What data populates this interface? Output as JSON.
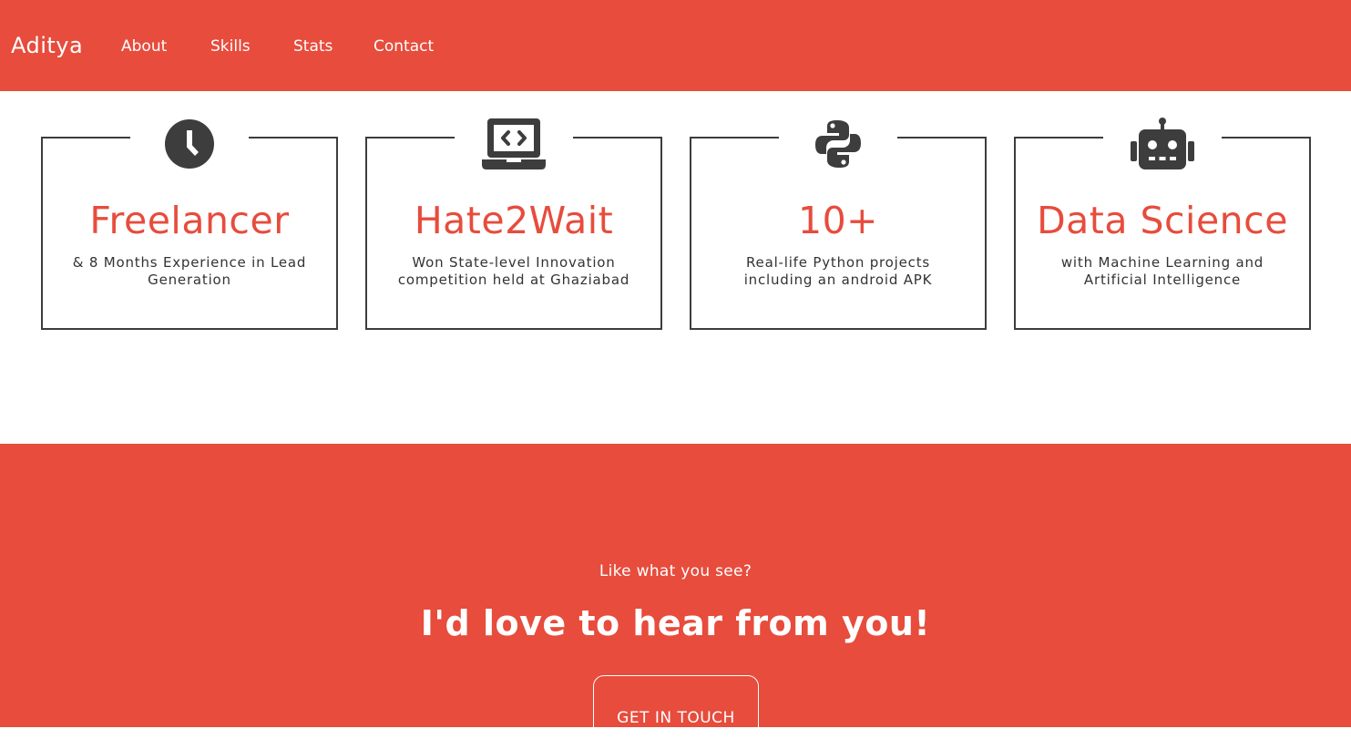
{
  "navbar": {
    "brand": "Aditya",
    "links": [
      {
        "label": "About"
      },
      {
        "label": "Skills"
      },
      {
        "label": "Stats"
      },
      {
        "label": "Contact"
      }
    ]
  },
  "stats": [
    {
      "icon": "clock-icon",
      "title": "Freelancer",
      "description": "& 8 Months Experience in Lead Generation"
    },
    {
      "icon": "laptop-code-icon",
      "title": "Hate2Wait",
      "description": "Won State-level Innovation competition held at Ghaziabad"
    },
    {
      "icon": "python-icon",
      "title": "10+",
      "description": "Real-life Python projects including an android APK"
    },
    {
      "icon": "robot-icon",
      "title": "Data Science",
      "description": "with Machine Learning and Artificial Intelligence"
    }
  ],
  "contact": {
    "subtitle": "Like what you see?",
    "heading": "I'd love to hear from you!",
    "button_label": "GET IN TOUCH"
  },
  "colors": {
    "accent": "#e74c3c",
    "text_dark": "#333333",
    "icon": "#3d3d3d",
    "border": "#3d3d3d",
    "background": "#ffffff"
  }
}
